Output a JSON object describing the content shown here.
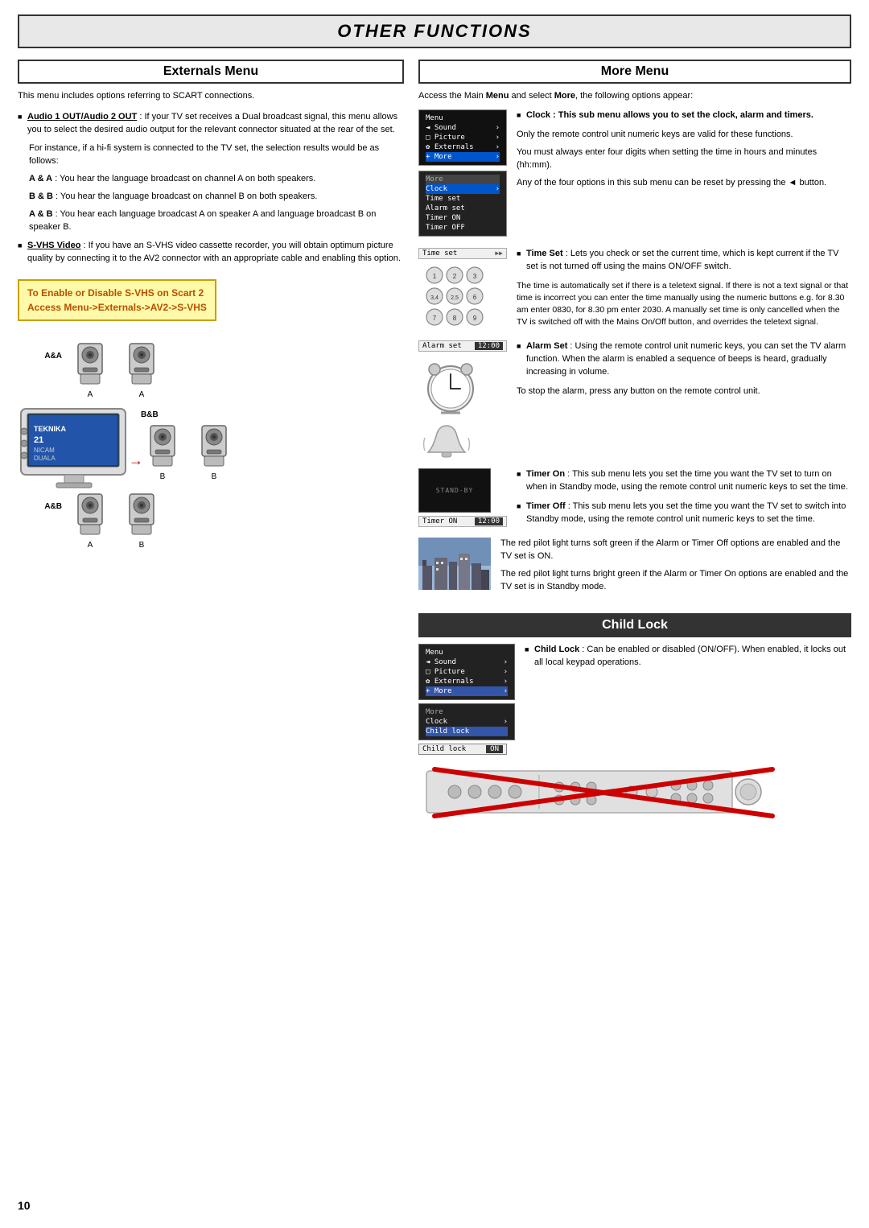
{
  "page": {
    "title": "OTHER FUNCTIONS",
    "number": "10"
  },
  "left": {
    "section_title": "Externals Menu",
    "intro": "This menu includes options referring to SCART connections.",
    "audio_bullet": {
      "label": "Audio 1 OUT/Audio 2 OUT",
      "text": " : If your TV set receives a Dual broadcast signal, this menu allows you to select the desired audio output for the relevant connector situated at the rear of the set."
    },
    "for_instance": "For instance, if a hi-fi system is connected to the TV set, the selection results would be as follows:",
    "options": [
      {
        "key": "A & A",
        "text": " : You hear the language broadcast on channel A on both speakers."
      },
      {
        "key": "B & B",
        "text": " : You hear the language broadcast on channel B on both speakers."
      },
      {
        "key": "A & B",
        "text": " : You hear each language broadcast A on speaker A and language broadcast B on speaker B."
      }
    ],
    "svhs_bullet": {
      "label": "S-VHS Video",
      "text": " : If you have an S-VHS video cassette recorder, you will obtain optimum picture quality by connecting it to the AV2 connector with an appropriate cable and enabling this option."
    },
    "highlight_line1": "To Enable or Disable S-VHS on Scart 2",
    "highlight_line2": "Access Menu->Externals->AV2->S-VHS",
    "labels": {
      "aa": "A&A",
      "bb": "B&B",
      "ab": "A&B",
      "a": "A",
      "b": "B"
    }
  },
  "right": {
    "more_section_title": "More Menu",
    "more_intro": "Access the Main Menu and select More, the following options appear:",
    "menu_items": [
      "Menu",
      "Sound",
      "Picture",
      "Externals",
      "+ More"
    ],
    "more_submenu": [
      "Clock",
      "Time set",
      "Alarm set",
      "Timer ON",
      "Timer OFF"
    ],
    "clock_bullet": "Clock : This sub menu allows you to set the clock, alarm and timers.",
    "only_remote": "Only the remote control unit numeric keys are valid for these functions.",
    "four_digits": "You must always enter four digits when setting the time in hours and minutes (hh:mm).",
    "four_options": "Any of the four options in this sub menu can be reset by pressing the ◄ button.",
    "timeset_bar": "Time set",
    "numpad_numbers": [
      "1",
      "2",
      "3",
      "3,4",
      "2,5",
      "6",
      "7",
      "8",
      "9"
    ],
    "timeset_bullet_label": "Time Set",
    "timeset_bullet": " : Lets you check or set the current time, which is kept current if the TV set is not turned off using the mains ON/OFF switch.",
    "auto_set": "The time is automatically set if there is a teletext signal.  If there is not a text signal or that time is incorrect you can enter the time manually using the numeric buttons e.g. for 8.30 am enter 0830, for 8.30 pm enter 2030. A manually set time is only cancelled when the TV is switched off with the Mains On/Off button, and overrides the teletext signal.",
    "alarm_bar": "Alarm set",
    "alarm_time": "12:00",
    "alarm_bullet_label": "Alarm Set",
    "alarm_bullet": " : Using the remote control unit numeric keys, you can set the TV alarm function. When the alarm is enabled a sequence of beeps is heard, gradually increasing in volume.",
    "stop_alarm": "To stop the alarm, press any button on the remote control unit.",
    "standby_label": "STAND-BY",
    "timer_on_bar_label": "Timer ON",
    "timer_on_time": "12:00",
    "timeron_bullet_label": "Timer On",
    "timeron_bullet": " : This sub menu lets you set the time you want the TV set to turn on when in Standby mode, using the remote control unit numeric keys to set the time.",
    "timeroff_bullet_label": "Timer Off",
    "timeroff_bullet": " : This sub menu lets you set the time you want the TV set to switch into Standby mode, using the remote control unit numeric keys to set the time.",
    "red_light_1": "The red pilot light turns soft green if the Alarm or Timer Off options are enabled and the TV set is ON.",
    "red_light_2": "The red pilot light turns bright green if the Alarm or Timer On options are enabled and the TV set is in Standby mode.",
    "child_lock": {
      "section_title": "Child Lock",
      "menu_items": [
        "Menu",
        "◄ Sound",
        "□ Picture",
        "✿ Externals",
        "+ More"
      ],
      "more_submenu_items": [
        "More",
        "Clock",
        "Child lock"
      ],
      "childlock_bar_label": "Child lock",
      "childlock_bar_value": "ON",
      "bullet_label": "Child Lock",
      "bullet_text": " : Can be enabled or disabled (ON/OFF).  When enabled, it locks out all local keypad operations."
    }
  }
}
